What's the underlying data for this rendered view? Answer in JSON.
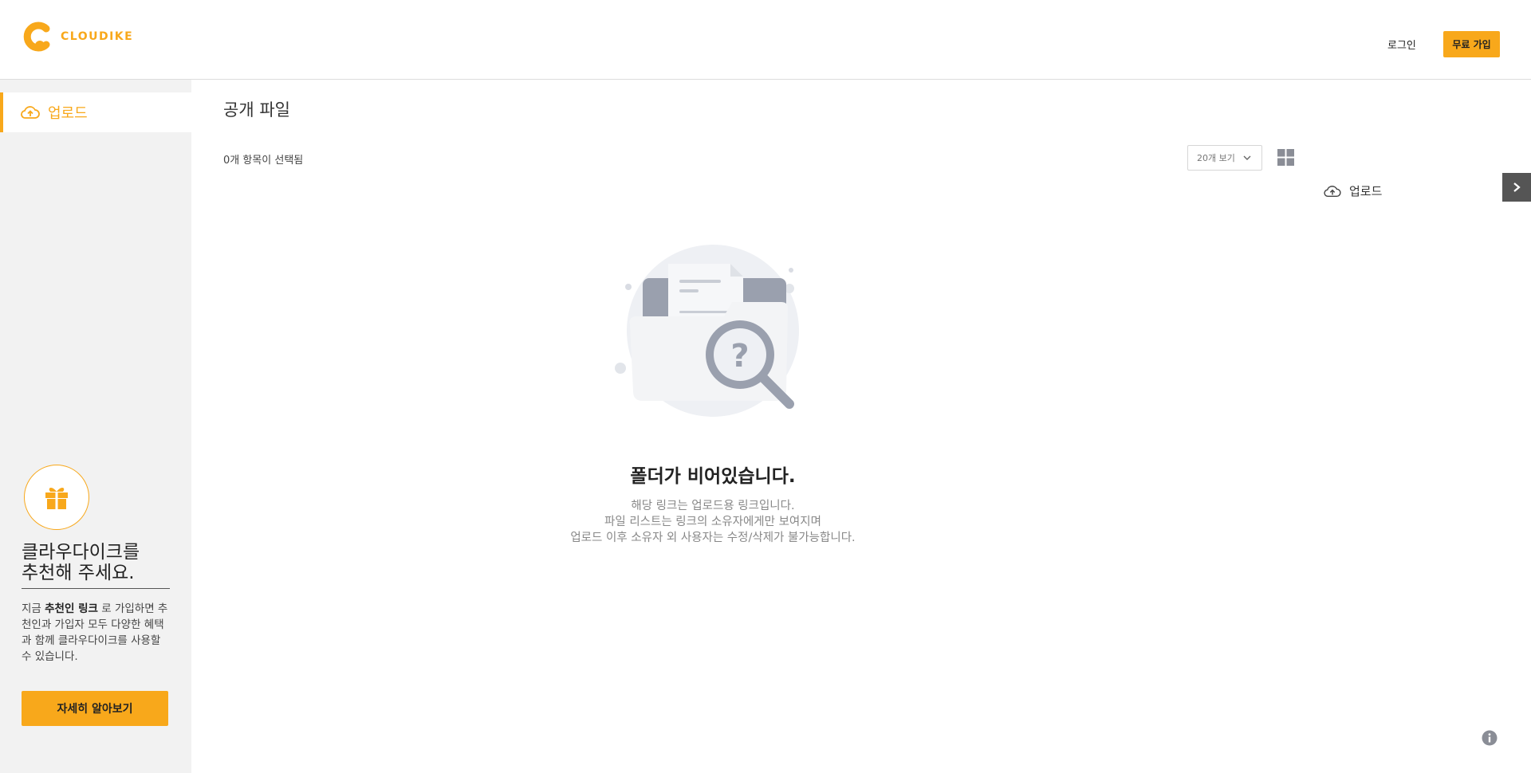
{
  "header": {
    "logo_text": "CLOUDIKE",
    "login_label": "로그인",
    "signup_label": "무료 가입",
    "accent": "#f8a81b"
  },
  "sidebar": {
    "items": [
      {
        "label": "업로드",
        "icon": "cloud-upload-icon"
      }
    ],
    "promo": {
      "title_line1": "클라우다이크를",
      "title_line2": "추천해 주세요.",
      "text_prefix": "지금 ",
      "text_bold": "추천인 링크",
      "text_suffix": " 로 가입하면 추천인과 가입자 모두 다양한 혜택과 함께 클라우다이크를 사용할 수 있습니다.",
      "button_label": "자세히 알아보기",
      "icon": "gift-icon"
    }
  },
  "main": {
    "title": "공개 파일",
    "selection_count": "0개 항목이 선택됨",
    "view_select_value": "20개 보기",
    "upload_label": "업로드",
    "empty": {
      "title": "폴더가 비어있습니다.",
      "line1": "해당 링크는 업로드용 링크입니다.",
      "line2": "파일 리스트는 링크의 소유자에게만 보여지며",
      "line3": "업로드 이후 소유자 외 사용자는 수정/삭제가 불가능합니다."
    }
  }
}
